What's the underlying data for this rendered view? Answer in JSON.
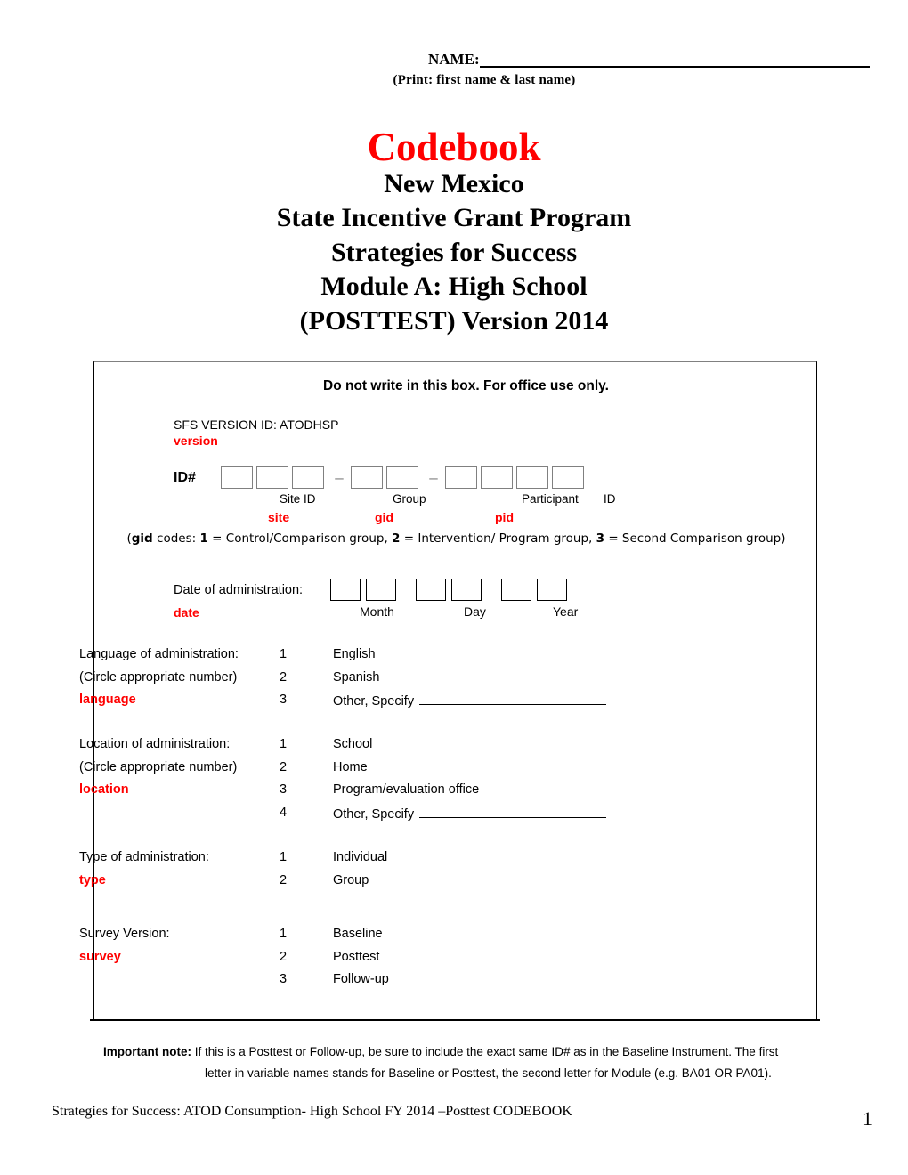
{
  "header": {
    "name_label": "NAME:",
    "print_caption": "(Print:    first name    &    last name)"
  },
  "title": {
    "main": "Codebook",
    "main_color": "#ff0000",
    "lines": [
      "New Mexico",
      "State Incentive Grant Program",
      "Strategies for Success",
      "Module A: High School",
      "(POSTTEST) Version 2014"
    ]
  },
  "office_box": {
    "heading": "Do not write in this box.  For office use only.",
    "version_id_label": "SFS VERSION ID:  ATODHSP",
    "version_var": "version",
    "id": {
      "label": "ID#",
      "site_boxes": 3,
      "group_boxes": 2,
      "participant_boxes": 4,
      "separator": "–",
      "sublabels": {
        "site": "Site ID",
        "group": "Group",
        "participant": "Participant",
        "id_word": "ID"
      },
      "vars": {
        "site": "site",
        "gid": "gid",
        "pid": "pid"
      },
      "gid_codes_prefix": "(",
      "gid_codes_bold": "gid",
      "gid_codes_text": " codes: ",
      "gid_codes": [
        {
          "num": "1",
          "text": " = Control/Comparison group, "
        },
        {
          "num": "2",
          "text": " = Intervention/ Program group, "
        },
        {
          "num": "3",
          "text": " = Second Comparison group)"
        }
      ]
    },
    "date": {
      "label": "Date of administration:",
      "var": "date",
      "month_label": "Month",
      "day_label": "Day",
      "year_label": "Year",
      "boxes_per_field": 2
    },
    "language": {
      "label": "Language of administration:",
      "sublabel": "(Circle appropriate number)",
      "var": "language",
      "options": [
        {
          "num": "1",
          "text": "English",
          "rule": false
        },
        {
          "num": "2",
          "text": "Spanish",
          "rule": false
        },
        {
          "num": "3",
          "text": "Other, Specify",
          "rule": true
        }
      ]
    },
    "location": {
      "label": "Location of administration:",
      "sublabel": "(Circle appropriate number)",
      "var": "location",
      "options": [
        {
          "num": "1",
          "text": "School",
          "rule": false
        },
        {
          "num": "2",
          "text": "Home",
          "rule": false
        },
        {
          "num": "3",
          "text": "Program/evaluation office",
          "rule": false
        },
        {
          "num": "4",
          "text": "Other, Specify",
          "rule": true
        }
      ]
    },
    "type": {
      "label": "Type of administration:",
      "var": "type",
      "options": [
        {
          "num": "1",
          "text": "Individual"
        },
        {
          "num": "2",
          "text": "Group"
        }
      ]
    },
    "survey": {
      "label": "Survey Version:",
      "var": "survey",
      "options": [
        {
          "num": "1",
          "text": "Baseline"
        },
        {
          "num": "2",
          "text": "Posttest"
        },
        {
          "num": "3",
          "text": "Follow-up"
        }
      ]
    }
  },
  "note": {
    "bold_prefix": "Important note:",
    "line1": " If this is a Posttest or Follow-up, be sure to include the exact same ID# as in the Baseline Instrument. The first",
    "line2": "letter in variable names stands for Baseline or Posttest, the second letter for Module (e.g. BA01 OR PA01)."
  },
  "footer": {
    "text": "Strategies for Success:  ATOD Consumption- High School FY 2014 –Posttest CODEBOOK",
    "page_number": "1"
  }
}
